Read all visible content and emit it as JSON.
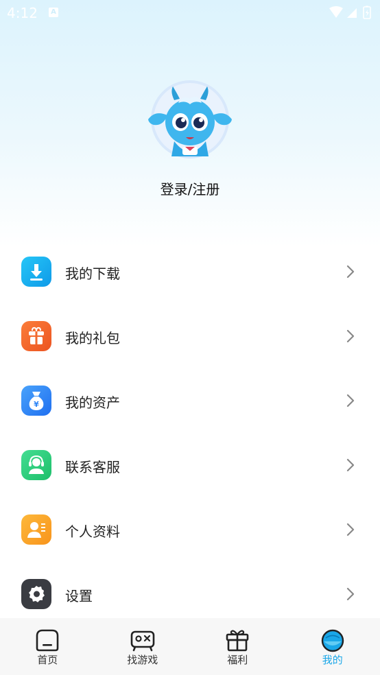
{
  "status_bar": {
    "time": "4:12",
    "notification_icon": "a-badge-icon",
    "icons": [
      "wifi-icon",
      "signal-icon",
      "battery-icon"
    ]
  },
  "profile": {
    "avatar_icon": "blue-goat-mascot-avatar",
    "login_label": "登录/注册"
  },
  "menu": {
    "items": [
      {
        "label": "我的下载",
        "icon": "download-icon",
        "color": "#1ab3f2"
      },
      {
        "label": "我的礼包",
        "icon": "gift-box-icon",
        "color": "#f36a2c"
      },
      {
        "label": "我的资产",
        "icon": "money-bag-icon",
        "color": "#2f86f6"
      },
      {
        "label": "联系客服",
        "icon": "customer-service-icon",
        "color": "#2fd07e"
      },
      {
        "label": "个人资料",
        "icon": "profile-card-icon",
        "color": "#fba52b"
      },
      {
        "label": "设置",
        "icon": "gear-icon",
        "color": "#3a3c42"
      }
    ]
  },
  "tab_bar": {
    "tabs": [
      {
        "label": "首页",
        "icon": "home-icon",
        "active": false
      },
      {
        "label": "找游戏",
        "icon": "gamepad-icon",
        "active": false
      },
      {
        "label": "福利",
        "icon": "gift-icon",
        "active": false
      },
      {
        "label": "我的",
        "icon": "mine-face-icon",
        "active": true
      }
    ],
    "active_color": "#1aa7e8"
  }
}
